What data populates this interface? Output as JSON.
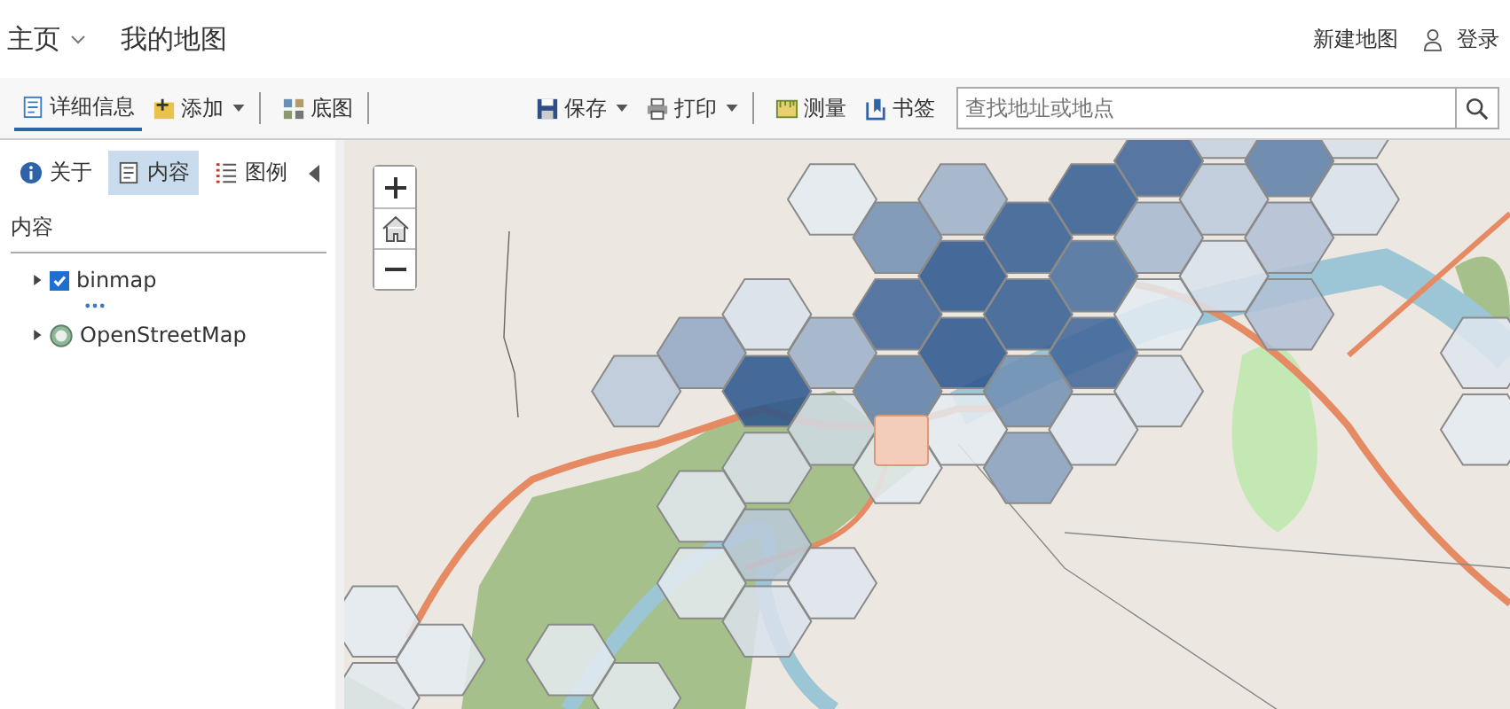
{
  "header": {
    "home": "主页",
    "map_title": "我的地图",
    "new_map": "新建地图",
    "sign_in": "登录"
  },
  "toolbar": {
    "left": [
      {
        "kind": "details",
        "label": "详细信息",
        "selected": true,
        "dropdown": false,
        "separator_after": false
      },
      {
        "kind": "add",
        "label": "添加",
        "selected": false,
        "dropdown": true,
        "separator_after": true
      },
      {
        "kind": "basemap",
        "label": "底图",
        "selected": false,
        "dropdown": false,
        "separator_after": true
      }
    ],
    "right": [
      {
        "kind": "save",
        "label": "保存",
        "dropdown": true,
        "separator_after": false
      },
      {
        "kind": "print",
        "label": "打印",
        "dropdown": true,
        "separator_after": true
      },
      {
        "kind": "measure",
        "label": "测量",
        "dropdown": false,
        "separator_after": false
      },
      {
        "kind": "bookmark",
        "label": "书签",
        "dropdown": false,
        "separator_after": false
      }
    ],
    "search": {
      "placeholder": "查找地址或地点"
    }
  },
  "side_panel": {
    "tabs": [
      {
        "kind": "about",
        "label": "关于",
        "selected": false
      },
      {
        "kind": "content",
        "label": "内容",
        "selected": true
      },
      {
        "kind": "legend",
        "label": "图例",
        "selected": false
      }
    ],
    "heading": "内容",
    "layers": [
      {
        "kind": "feature",
        "name": "binmap",
        "checked": true,
        "expanded": false
      },
      {
        "kind": "basemap",
        "name": "OpenStreetMap",
        "expanded": false
      }
    ]
  }
}
